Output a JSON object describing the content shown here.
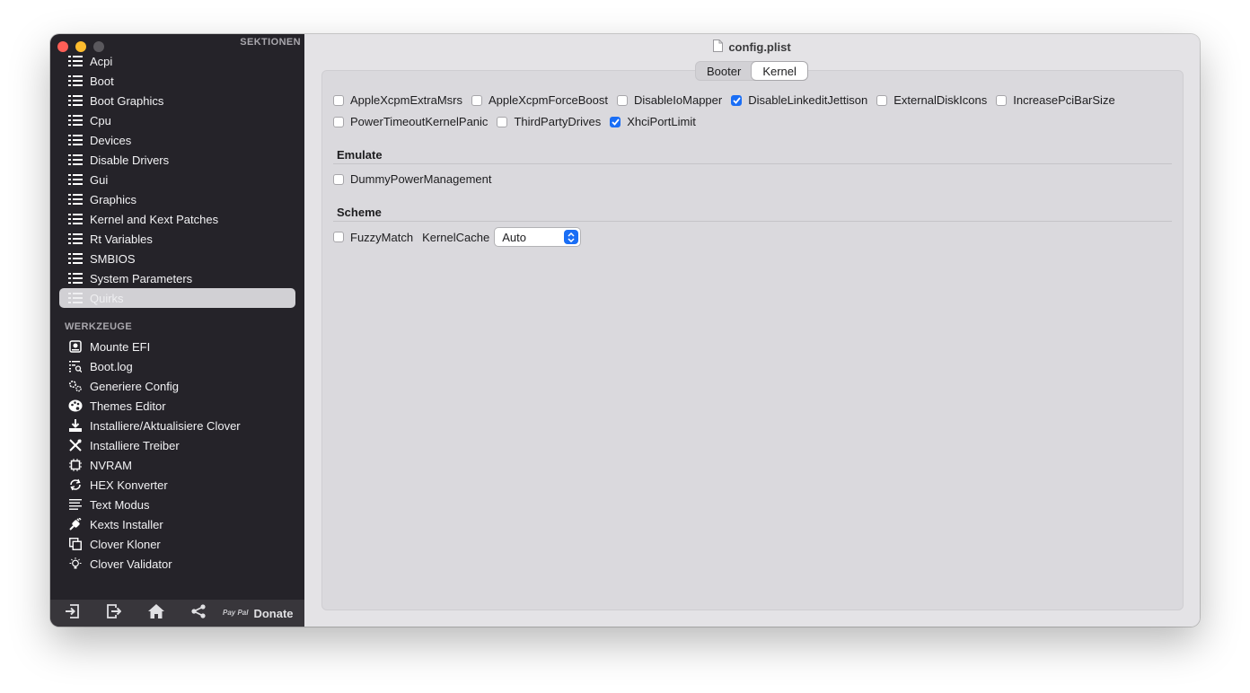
{
  "window": {
    "title": "config.plist"
  },
  "sidebar": {
    "sections_header": "SEKTIONEN",
    "sections": [
      {
        "label": "Acpi"
      },
      {
        "label": "Boot"
      },
      {
        "label": "Boot Graphics"
      },
      {
        "label": "Cpu"
      },
      {
        "label": "Devices"
      },
      {
        "label": "Disable Drivers"
      },
      {
        "label": "Gui"
      },
      {
        "label": "Graphics"
      },
      {
        "label": "Kernel and Kext Patches"
      },
      {
        "label": "Rt Variables"
      },
      {
        "label": "SMBIOS"
      },
      {
        "label": "System Parameters"
      },
      {
        "label": "Quirks",
        "selected": true
      }
    ],
    "tools_header": "WERKZEUGE",
    "tools": [
      {
        "label": "Mounte EFI",
        "icon": "disk-icon"
      },
      {
        "label": "Boot.log",
        "icon": "log-search-icon"
      },
      {
        "label": "Generiere Config",
        "icon": "gears-icon"
      },
      {
        "label": "Themes Editor",
        "icon": "palette-icon"
      },
      {
        "label": "Installiere/Aktualisiere Clover",
        "icon": "download-icon"
      },
      {
        "label": "Installiere Treiber",
        "icon": "tools-icon"
      },
      {
        "label": "NVRAM",
        "icon": "chip-icon"
      },
      {
        "label": "HEX Konverter",
        "icon": "convert-icon"
      },
      {
        "label": "Text Modus",
        "icon": "text-lines-icon"
      },
      {
        "label": "Kexts Installer",
        "icon": "plug-icon"
      },
      {
        "label": "Clover Kloner",
        "icon": "clone-icon"
      },
      {
        "label": "Clover Validator",
        "icon": "lightbulb-icon"
      }
    ],
    "bottom": {
      "donate_label": "Donate",
      "paypal_text": "Pay Pal"
    }
  },
  "main": {
    "tabs": [
      {
        "label": "Booter",
        "active": false
      },
      {
        "label": "Kernel",
        "active": true
      }
    ],
    "kernel_options": [
      {
        "label": "AppleXcpmExtraMsrs",
        "checked": false
      },
      {
        "label": "AppleXcpmForceBoost",
        "checked": false
      },
      {
        "label": "DisableIoMapper",
        "checked": false
      },
      {
        "label": "DisableLinkeditJettison",
        "checked": true
      },
      {
        "label": "ExternalDiskIcons",
        "checked": false
      },
      {
        "label": "IncreasePciBarSize",
        "checked": false
      },
      {
        "label": "PowerTimeoutKernelPanic",
        "checked": false
      },
      {
        "label": "ThirdPartyDrives",
        "checked": false
      },
      {
        "label": "XhciPortLimit",
        "checked": true
      }
    ],
    "emulate": {
      "title": "Emulate",
      "options": [
        {
          "label": "DummyPowerManagement",
          "checked": false
        }
      ]
    },
    "scheme": {
      "title": "Scheme",
      "fuzzy_match": {
        "label": "FuzzyMatch",
        "checked": false
      },
      "kernel_cache_label": "KernelCache",
      "kernel_cache_value": "Auto"
    }
  },
  "colors": {
    "accent": "#1a6ef5",
    "sidebar_bg": "#252329",
    "content_bg": "#e4e3e6"
  }
}
